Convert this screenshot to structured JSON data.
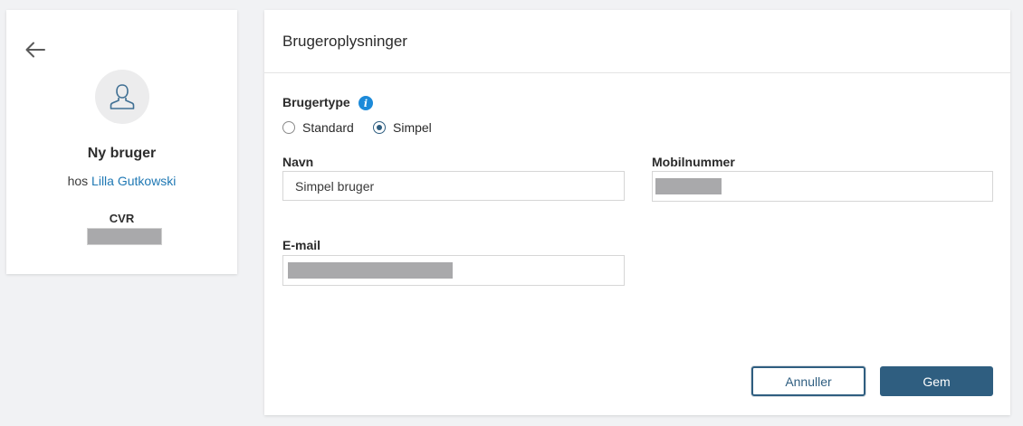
{
  "sidebar": {
    "back_icon": "arrow-left-icon",
    "avatar_icon": "user-outline-icon",
    "title": "Ny bruger",
    "org_prefix": "hos",
    "org_name": "Lilla Gutkowski",
    "cvr_label": "CVR",
    "cvr_value": ""
  },
  "form": {
    "title": "Brugeroplysninger",
    "user_type": {
      "label": "Brugertype",
      "info_icon": "info-icon",
      "options": [
        "Standard",
        "Simpel"
      ],
      "selected": "Simpel"
    },
    "name": {
      "label": "Navn",
      "value": "Simpel bruger"
    },
    "mobile": {
      "label": "Mobilnummer",
      "value": ""
    },
    "email": {
      "label": "E-mail",
      "value": ""
    },
    "buttons": {
      "cancel": "Annuller",
      "save": "Gem"
    }
  },
  "colors": {
    "accent": "#2f5e80",
    "link": "#1f78b4",
    "info": "#1c8ad9",
    "redaction": "#a9a9ab"
  }
}
